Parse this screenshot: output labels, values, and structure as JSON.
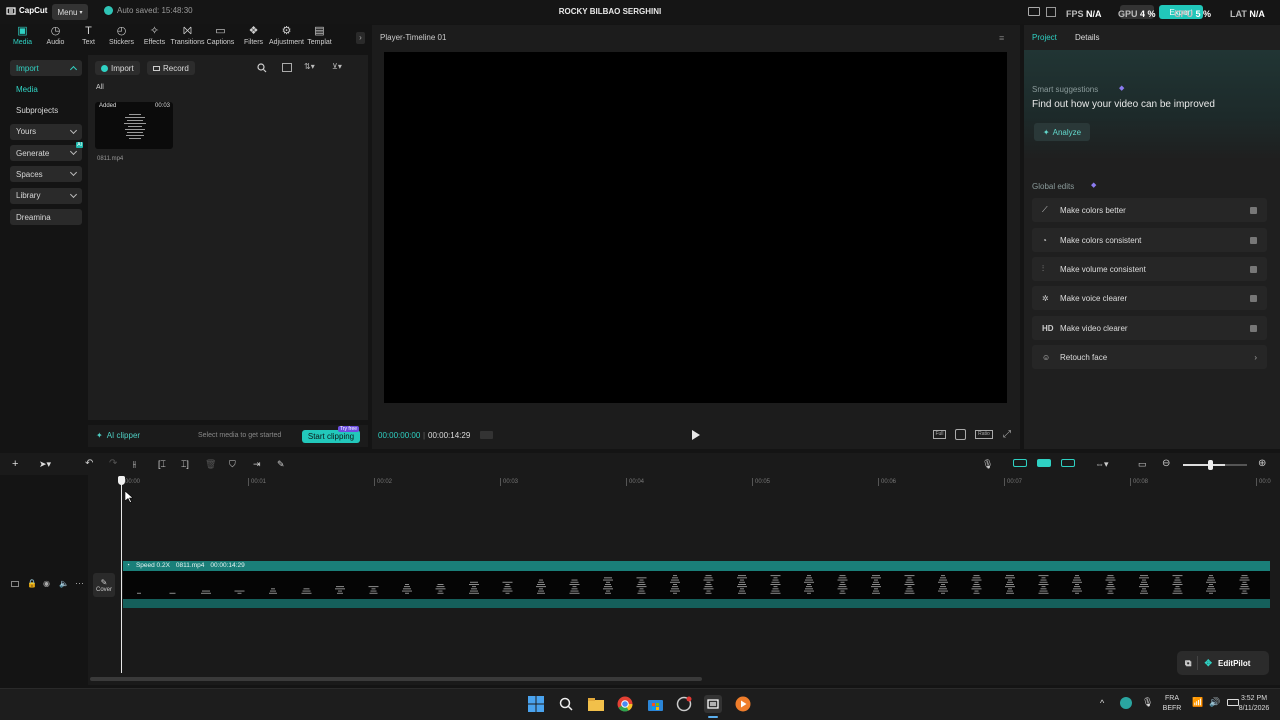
{
  "titlebar": {
    "logo": "CapCut",
    "menu": "Menu",
    "autosave": "Auto saved: 15:48:30",
    "project_title": "ROCKY BILBAO SERGHINI",
    "fps_label": "FPS",
    "fps_value": "N/A",
    "gpu_label": "GPU",
    "gpu_value": "4 %",
    "cpu_label": "CPU",
    "cpu_value": "5 %",
    "lat_label": "LAT",
    "lat_value": "N/A",
    "export": "Export"
  },
  "tools": [
    {
      "label": "Media",
      "icon": "media-icon"
    },
    {
      "label": "Audio",
      "icon": "audio-icon"
    },
    {
      "label": "Text",
      "icon": "text-icon"
    },
    {
      "label": "Stickers",
      "icon": "stickers-icon"
    },
    {
      "label": "Effects",
      "icon": "effects-icon"
    },
    {
      "label": "Transitions",
      "icon": "transitions-icon"
    },
    {
      "label": "Captions",
      "icon": "captions-icon"
    },
    {
      "label": "Filters",
      "icon": "filters-icon"
    },
    {
      "label": "Adjustment",
      "icon": "adjustment-icon"
    },
    {
      "label": "Templat",
      "icon": "templates-icon"
    }
  ],
  "leftnav": {
    "import": "Import",
    "media": "Media",
    "subprojects": "Subprojects",
    "yours": "Yours",
    "generate": "Generate",
    "spaces": "Spaces",
    "library": "Library",
    "dreamina": "Dreamina",
    "ai_badge": "AI"
  },
  "media_pane": {
    "import_btn": "Import",
    "record_btn": "Record",
    "filter_all": "All",
    "clip": {
      "badge": "Added",
      "duration": "00:03",
      "filename": "0811.mp4"
    }
  },
  "media_bottom": {
    "ai_clipper": "AI clipper",
    "hint": "Select media to get started",
    "start_clipping": "Start clipping",
    "try_free": "Try free"
  },
  "player": {
    "title": "Player-Timeline 01",
    "current_time": "00:00:00:00",
    "total_time": "00:00:14:29",
    "full_label": "Full",
    "ratio_label": "Ratio"
  },
  "right_panel": {
    "tab_project": "Project",
    "tab_details": "Details",
    "smart_title": "Smart suggestions",
    "smart_text": "Find out how your video can be improved",
    "analyze": "Analyze",
    "global_title": "Global edits",
    "edits": [
      {
        "label": "Make colors better",
        "icon": "magic-wand-icon"
      },
      {
        "label": "Make colors consistent",
        "icon": "palette-icon"
      },
      {
        "label": "Make volume consistent",
        "icon": "sliders-icon"
      },
      {
        "label": "Make voice clearer",
        "icon": "voice-icon"
      },
      {
        "label": "Make video clearer",
        "icon": "hd-icon",
        "glyph": "HD"
      },
      {
        "label": "Retouch face",
        "icon": "face-icon"
      }
    ]
  },
  "timeline": {
    "ruler": [
      "00:00",
      "00:01",
      "00:02",
      "00:03",
      "00:04",
      "00:05",
      "00:06",
      "00:07",
      "00:08",
      "00:0"
    ],
    "clip_speed": "Speed 0.2X",
    "clip_name": "0811.mp4",
    "clip_duration": "00:00:14:29",
    "cover": "Cover",
    "editpilot": "EditPilot"
  },
  "taskbar": {
    "lang_top": "FRA",
    "lang_bottom": "BEFR",
    "time": "3:52 PM",
    "date": "8/11/2026"
  },
  "colors": {
    "accent": "#2fd1c3",
    "track": "#1a7f79",
    "background": "#141414"
  }
}
